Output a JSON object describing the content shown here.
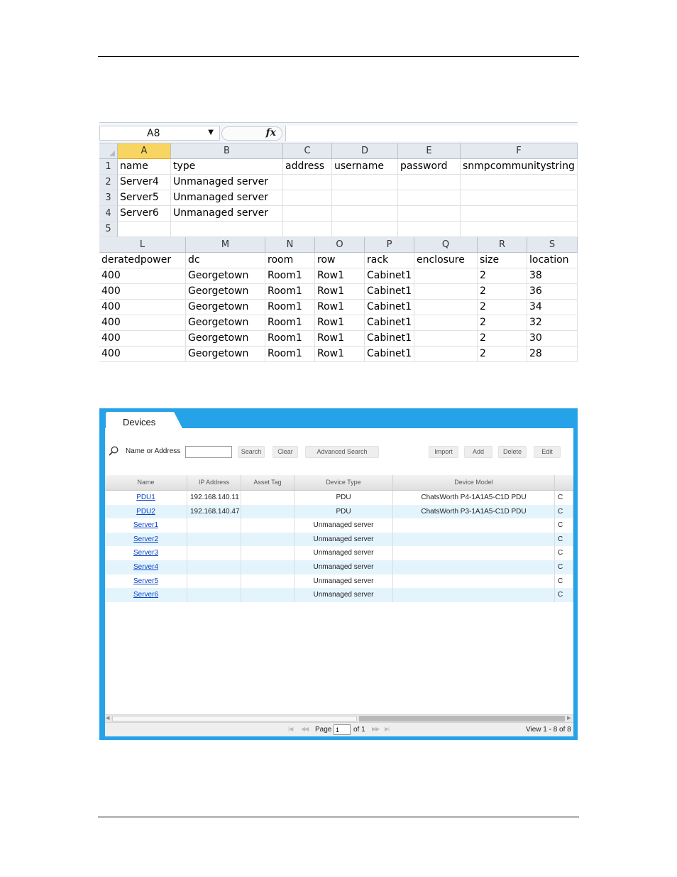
{
  "spreadsheet": {
    "name_box": "A8",
    "fx_label": "fx",
    "top_columns": [
      "A",
      "B",
      "C",
      "D",
      "E",
      "F"
    ],
    "top_rows": [
      {
        "num": "1",
        "cells": [
          "name",
          "type",
          "address",
          "username",
          "password",
          "snmpcommunitystring"
        ]
      },
      {
        "num": "2",
        "cells": [
          "Server4",
          "Unmanaged server",
          "",
          "",
          "",
          ""
        ]
      },
      {
        "num": "3",
        "cells": [
          "Server5",
          "Unmanaged server",
          "",
          "",
          "",
          ""
        ]
      },
      {
        "num": "4",
        "cells": [
          "Server6",
          "Unmanaged server",
          "",
          "",
          "",
          ""
        ]
      },
      {
        "num": "5",
        "cells": [
          "",
          "",
          "",
          "",
          "",
          ""
        ]
      }
    ],
    "bottom_columns": [
      "L",
      "M",
      "N",
      "O",
      "P",
      "Q",
      "R",
      "S"
    ],
    "bottom_rows": [
      [
        "deratedpower",
        "dc",
        "room",
        "row",
        "rack",
        "enclosure",
        "size",
        "location"
      ],
      [
        "400",
        "Georgetown",
        "Room1",
        "Row1",
        "Cabinet1",
        "",
        "2",
        "38"
      ],
      [
        "400",
        "Georgetown",
        "Room1",
        "Row1",
        "Cabinet1",
        "",
        "2",
        "36"
      ],
      [
        "400",
        "Georgetown",
        "Room1",
        "Row1",
        "Cabinet1",
        "",
        "2",
        "34"
      ],
      [
        "400",
        "Georgetown",
        "Room1",
        "Row1",
        "Cabinet1",
        "",
        "2",
        "32"
      ],
      [
        "400",
        "Georgetown",
        "Room1",
        "Row1",
        "Cabinet1",
        "",
        "2",
        "30"
      ],
      [
        "400",
        "Georgetown",
        "Room1",
        "Row1",
        "Cabinet1",
        "",
        "2",
        "28"
      ]
    ]
  },
  "devices": {
    "tab_label": "Devices",
    "search_label": "Name or Address",
    "search_value": "",
    "buttons": {
      "search": "Search",
      "clear": "Clear",
      "advanced_search": "Advanced Search",
      "import": "Import",
      "add": "Add",
      "delete": "Delete",
      "edit": "Edit"
    },
    "columns": [
      "Name",
      "IP Address",
      "Asset Tag",
      "Device Type",
      "Device Model"
    ],
    "rows": [
      {
        "name": "PDU1",
        "ip": "192.168.140.11",
        "asset": "",
        "type": "PDU",
        "model": "ChatsWorth P4-1A1A5-C1D PDU",
        "cut": "C"
      },
      {
        "name": "PDU2",
        "ip": "192.168.140.47",
        "asset": "",
        "type": "PDU",
        "model": "ChatsWorth P3-1A1A5-C1D PDU",
        "cut": "C"
      },
      {
        "name": "Server1",
        "ip": "",
        "asset": "",
        "type": "Unmanaged server",
        "model": "",
        "cut": "C"
      },
      {
        "name": "Server2",
        "ip": "",
        "asset": "",
        "type": "Unmanaged server",
        "model": "",
        "cut": "C"
      },
      {
        "name": "Server3",
        "ip": "",
        "asset": "",
        "type": "Unmanaged server",
        "model": "",
        "cut": "C"
      },
      {
        "name": "Server4",
        "ip": "",
        "asset": "",
        "type": "Unmanaged server",
        "model": "",
        "cut": "C"
      },
      {
        "name": "Server5",
        "ip": "",
        "asset": "",
        "type": "Unmanaged server",
        "model": "",
        "cut": "C"
      },
      {
        "name": "Server6",
        "ip": "",
        "asset": "",
        "type": "Unmanaged server",
        "model": "",
        "cut": "C"
      }
    ],
    "pager": {
      "page_label": "Page",
      "page_value": "1",
      "of_label": "of 1",
      "view_text": "View 1 - 8 of 8"
    }
  }
}
